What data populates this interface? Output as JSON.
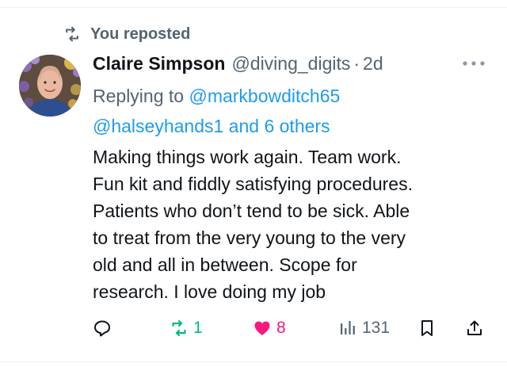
{
  "repost_banner": {
    "text": "You reposted",
    "icon": "repost-icon"
  },
  "author": {
    "name": "Claire Simpson",
    "handle": "@diving_digits",
    "separator": "·",
    "time": "2d",
    "avatar": "profile-photo"
  },
  "reply": {
    "prefix": "Replying to ",
    "mention1": "@markbowditch65",
    "mention2": "@halseyhands1",
    "joiner": " and ",
    "others": "6 others"
  },
  "post": {
    "lines": [
      "Making things work again. Team work.",
      "Fun kit and fiddly satisfying procedures.",
      "Patients who don’t tend to be sick. Able",
      "to treat from the very young to the very",
      "old and all in between. Scope for",
      "research. I love doing my job"
    ]
  },
  "actions": {
    "reply_count": "",
    "repost_count": "1",
    "like_count": "8",
    "view_count": "131"
  },
  "colors": {
    "text": "#0f1419",
    "secondary": "#536471",
    "link": "#1d9bf0",
    "repost_active": "#00ba7c",
    "like_active": "#f91880"
  }
}
